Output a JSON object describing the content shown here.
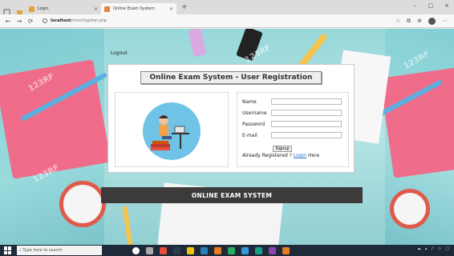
{
  "browser": {
    "tabs": [
      {
        "title": "Login",
        "active": false
      },
      {
        "title": "Online Exam System",
        "active": true
      }
    ],
    "new_tab_symbol": "+",
    "url_host": "localhost",
    "url_path": "/mun/register.php",
    "window_controls": [
      "–",
      "▢",
      "×"
    ],
    "nav": {
      "back": "←",
      "forward": "→",
      "reload": "⟳"
    }
  },
  "page": {
    "logout_text": "Logout",
    "card_title": "Online Exam System - User Registration",
    "form": {
      "name_label": "Name",
      "username_label": "Username",
      "password_label": "Password",
      "email_label": "E-mail",
      "signup_label": "Signup",
      "already_text": "Already Registered ?",
      "login_link": "Login",
      "here_text": "Here"
    },
    "banner": "ONLINE EXAM SYSTEM",
    "watermarks": [
      "123RF",
      "123RF",
      "123RF",
      "123RF"
    ]
  },
  "taskbar": {
    "search_placeholder": "Type here to search"
  },
  "colors": {
    "banner_bg": "#3c3a3a",
    "accent_circle": "#6fc3e6",
    "link": "#2a6fd0",
    "notebook": "#ef6c8a"
  }
}
